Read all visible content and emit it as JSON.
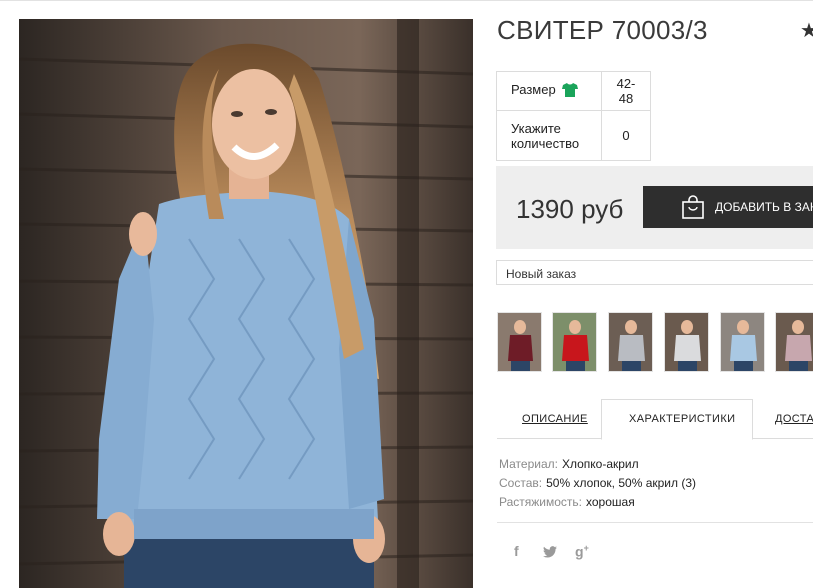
{
  "product": {
    "title": "СВИТЕР 70003/3",
    "favorite_icon": "star-icon"
  },
  "specs": [
    {
      "label": "Размер",
      "value": "42-48",
      "icon": "tshirt-icon",
      "icon_color": "#1aa45a"
    },
    {
      "label": "Укажите количество",
      "value": "0"
    }
  ],
  "purchase": {
    "price": "1390 руб",
    "add_button_label": "ДОБАВИТЬ В ЗАКАЗ",
    "button_icon": "shopping-bag-icon"
  },
  "order_select": {
    "selected": "Новый заказ"
  },
  "colors": {
    "accent": "#2e2e2e",
    "sweater": "#8fb4d8"
  },
  "gallery": {
    "thumbnails": [
      {
        "name": "thumb-burgundy",
        "color": "#6e1c27"
      },
      {
        "name": "thumb-red",
        "color": "#c8161c"
      },
      {
        "name": "thumb-grey",
        "color": "#b9bcc2"
      },
      {
        "name": "thumb-white",
        "color": "#dadbdd"
      },
      {
        "name": "thumb-light-blue",
        "color": "#a9c8e3"
      },
      {
        "name": "thumb-pink",
        "color": "#c7a7ae"
      }
    ]
  },
  "tabs": [
    {
      "label": "ОПИСАНИЕ"
    },
    {
      "label": "ХАРАКТЕРИСТИКИ"
    },
    {
      "label": "ДОСТАВКА"
    }
  ],
  "properties": [
    {
      "key": "Материал:",
      "value": "Хлопко-акрил"
    },
    {
      "key": "Состав:",
      "value": "50% хлопок, 50% акрил (3)"
    },
    {
      "key": "Растяжимость:",
      "value": "хорошая"
    }
  ],
  "social": [
    {
      "label": "f",
      "icon": "facebook-icon"
    },
    {
      "label": "🐦",
      "icon": "twitter-icon"
    },
    {
      "label": "g+",
      "icon": "google-plus-icon"
    }
  ]
}
